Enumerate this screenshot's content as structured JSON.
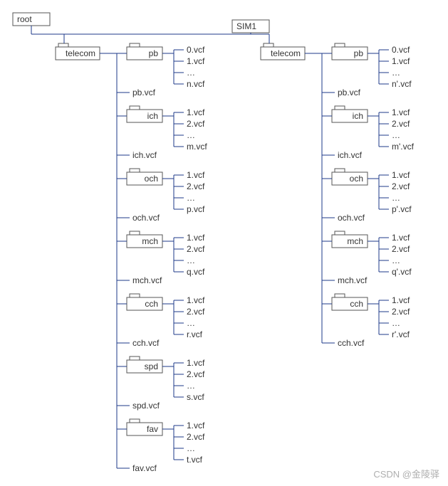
{
  "root": {
    "label": "root"
  },
  "sim1": {
    "label": "SIM1"
  },
  "left": {
    "telecom": "telecom",
    "folders": {
      "pb": {
        "name": "pb",
        "files": [
          "0.vcf",
          "1.vcf",
          "…",
          "n.vcf"
        ]
      },
      "ich": {
        "name": "ich",
        "files": [
          "1.vcf",
          "2.vcf",
          "…",
          "m.vcf"
        ]
      },
      "och": {
        "name": "och",
        "files": [
          "1.vcf",
          "2.vcf",
          "…",
          "p.vcf"
        ]
      },
      "mch": {
        "name": "mch",
        "files": [
          "1.vcf",
          "2.vcf",
          "…",
          "q.vcf"
        ]
      },
      "cch": {
        "name": "cch",
        "files": [
          "1.vcf",
          "2.vcf",
          "…",
          "r.vcf"
        ]
      },
      "spd": {
        "name": "spd",
        "files": [
          "1.vcf",
          "2.vcf",
          "…",
          "s.vcf"
        ]
      },
      "fav": {
        "name": "fav",
        "files": [
          "1.vcf",
          "2.vcf",
          "…",
          "t.vcf"
        ]
      }
    },
    "vcfs": {
      "pb": "pb.vcf",
      "ich": "ich.vcf",
      "och": "och.vcf",
      "mch": "mch.vcf",
      "cch": "cch.vcf",
      "spd": "spd.vcf",
      "fav": "fav.vcf"
    }
  },
  "right": {
    "telecom": "telecom",
    "folders": {
      "pb": {
        "name": "pb",
        "files": [
          "0.vcf",
          "1.vcf",
          "…",
          "n'.vcf"
        ]
      },
      "ich": {
        "name": "ich",
        "files": [
          "1.vcf",
          "2.vcf",
          "…",
          "m'.vcf"
        ]
      },
      "och": {
        "name": "och",
        "files": [
          "1.vcf",
          "2.vcf",
          "…",
          "p'.vcf"
        ]
      },
      "mch": {
        "name": "mch",
        "files": [
          "1.vcf",
          "2.vcf",
          "…",
          "q'.vcf"
        ]
      },
      "cch": {
        "name": "cch",
        "files": [
          "1.vcf",
          "2.vcf",
          "…",
          "r'.vcf"
        ]
      }
    },
    "vcfs": {
      "pb": "pb.vcf",
      "ich": "ich.vcf",
      "och": "och.vcf",
      "mch": "mch.vcf",
      "cch": "cch.vcf"
    }
  },
  "watermark": "CSDN @金陵驿"
}
